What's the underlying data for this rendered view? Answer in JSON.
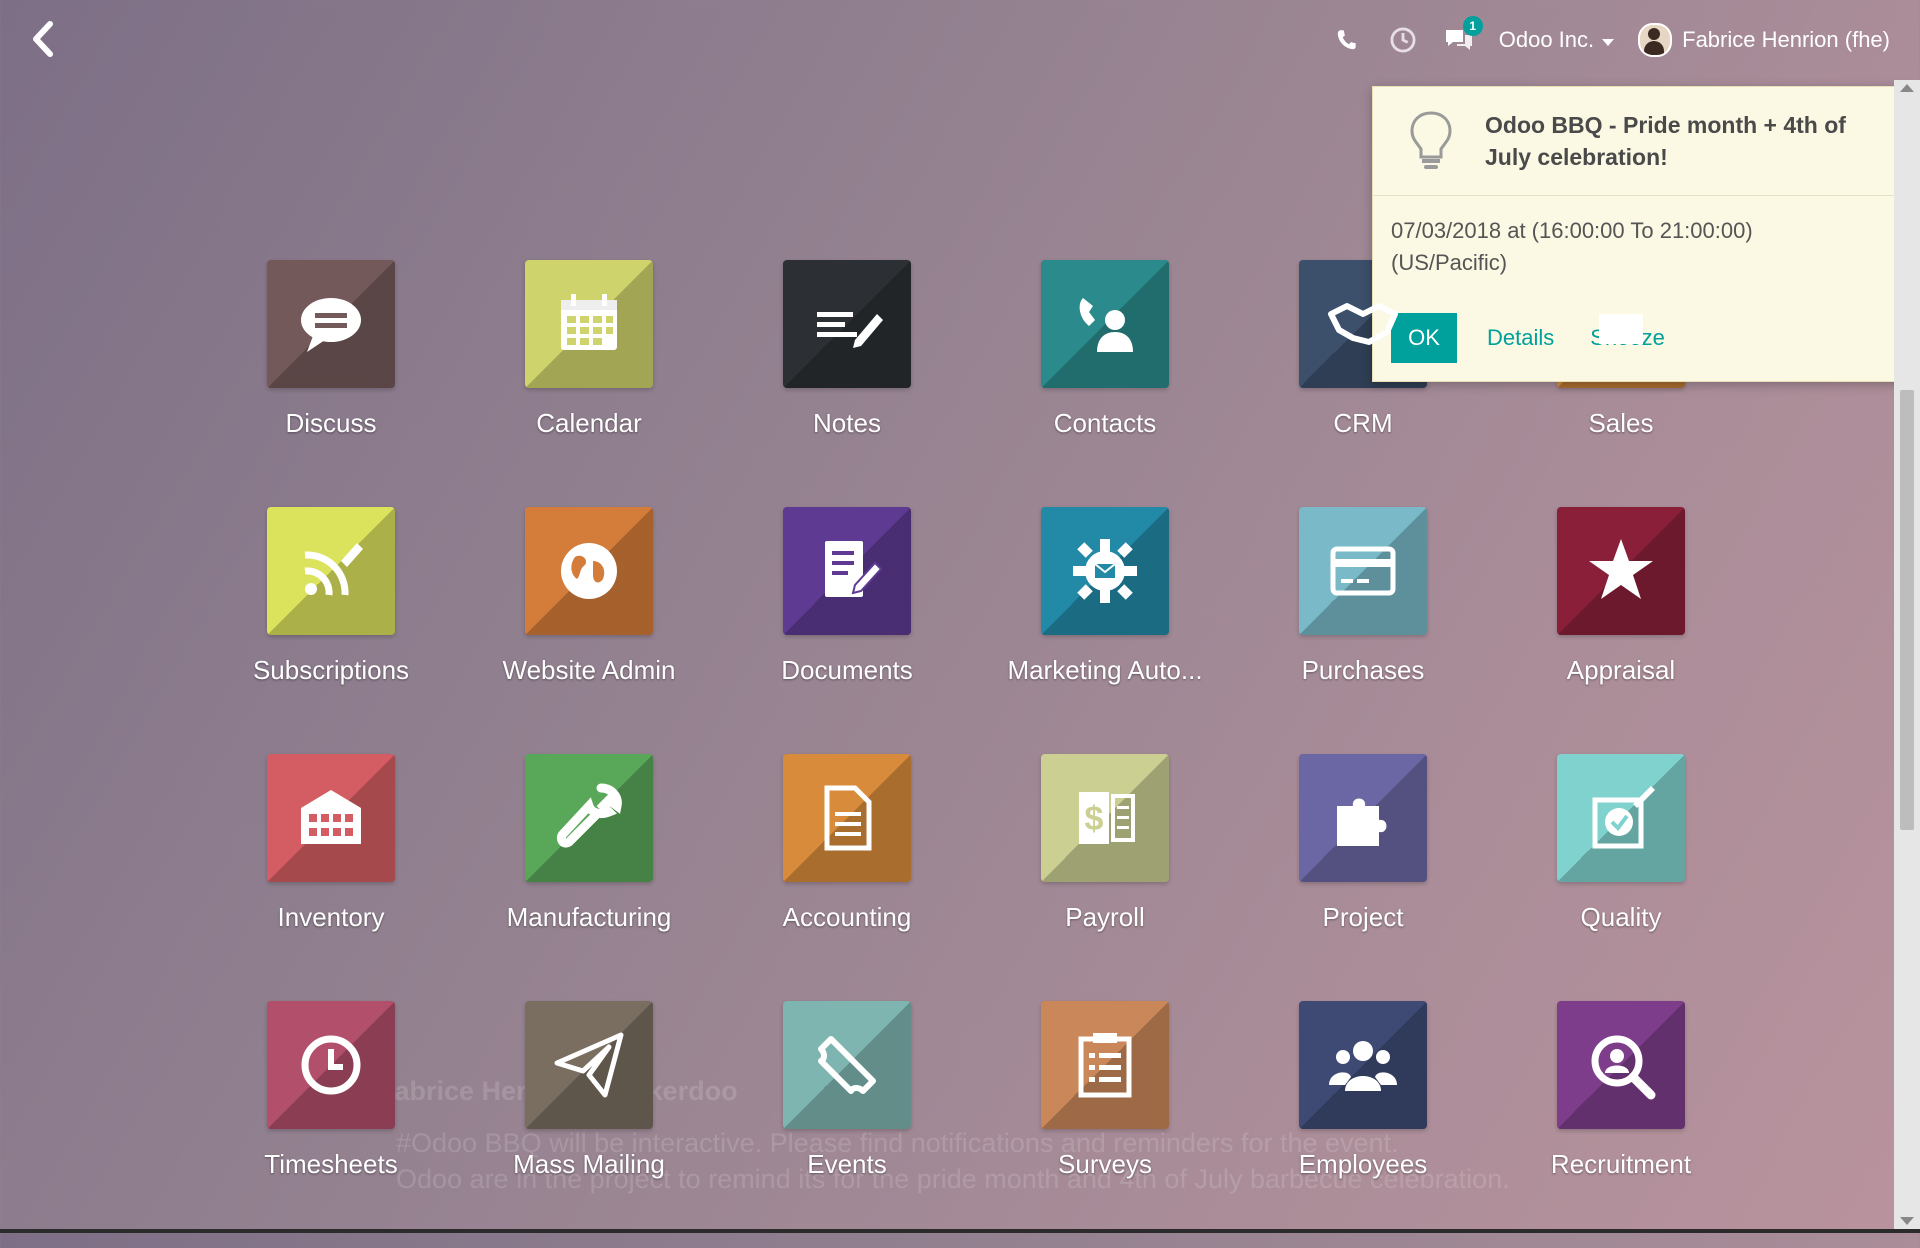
{
  "topbar": {
    "company": "Odoo Inc.",
    "user": "Fabrice Henrion (fhe)",
    "messages_count": "1",
    "icons": [
      "back-icon",
      "phone-icon",
      "clock-icon",
      "chat-icon"
    ]
  },
  "apps": [
    {
      "label": "Discuss",
      "color": "#735959",
      "icon": "chat-bubble-icon"
    },
    {
      "label": "Calendar",
      "color": "#cfd36b",
      "icon": "calendar-icon"
    },
    {
      "label": "Notes",
      "color": "#2c2f33",
      "icon": "notes-icon"
    },
    {
      "label": "Contacts",
      "color": "#2a8a8c",
      "icon": "contacts-icon"
    },
    {
      "label": "CRM",
      "color": "#3c4f6b",
      "icon": "handshake-icon"
    },
    {
      "label": "Sales",
      "color": "#d88b3c",
      "icon": "sales-icon"
    },
    {
      "label": "Subscriptions",
      "color": "#dbe35c",
      "icon": "rss-icon"
    },
    {
      "label": "Website Admin",
      "color": "#d47c3a",
      "icon": "globe-icon"
    },
    {
      "label": "Documents",
      "color": "#5e3a92",
      "icon": "document-pen-icon"
    },
    {
      "label": "Marketing Auto...",
      "color": "#2289a6",
      "icon": "gear-mail-icon"
    },
    {
      "label": "Purchases",
      "color": "#79b9c8",
      "icon": "credit-card-icon"
    },
    {
      "label": "Appraisal",
      "color": "#8a1f3a",
      "icon": "star-icon"
    },
    {
      "label": "Inventory",
      "color": "#d45d63",
      "icon": "warehouse-icon"
    },
    {
      "label": "Manufacturing",
      "color": "#59a758",
      "icon": "wrench-icon"
    },
    {
      "label": "Accounting",
      "color": "#d88c3b",
      "icon": "invoice-icon"
    },
    {
      "label": "Payroll",
      "color": "#cbd092",
      "icon": "payroll-icon"
    },
    {
      "label": "Project",
      "color": "#6b67a4",
      "icon": "puzzle-icon"
    },
    {
      "label": "Quality",
      "color": "#80d2ce",
      "icon": "quality-icon"
    },
    {
      "label": "Timesheets",
      "color": "#b24f6a",
      "icon": "clock-icon"
    },
    {
      "label": "Mass Mailing",
      "color": "#7a6e60",
      "icon": "paper-plane-icon"
    },
    {
      "label": "Events",
      "color": "#7fb5b0",
      "icon": "ticket-icon"
    },
    {
      "label": "Surveys",
      "color": "#c9875a",
      "icon": "clipboard-icon"
    },
    {
      "label": "Employees",
      "color": "#3e4a73",
      "icon": "users-icon"
    },
    {
      "label": "Recruitment",
      "color": "#7d3d8a",
      "icon": "search-user-icon"
    }
  ],
  "notification": {
    "title": "Odoo BBQ - Pride month + 4th of July celebration!",
    "datetime": "07/03/2018 at (16:00:00 To 21:00:00)",
    "timezone": "(US/Pacific)",
    "ok_label": "OK",
    "details_label": "Details",
    "snooze_label": "Snooze"
  },
  "ghost_text": {
    "title": "Fabrice Henrion - Tinkerdoo",
    "line1": "#Odoo BBQ will be interactive. Please find notifications and reminders for the event.",
    "line2": "Odoo are in the project to remind its for the pride month and 4th of July barbecue celebration."
  }
}
